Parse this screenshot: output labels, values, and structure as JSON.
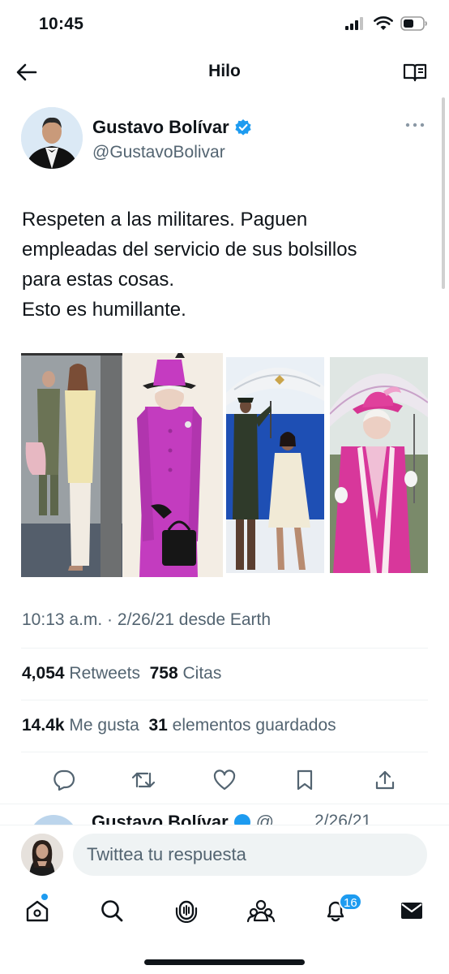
{
  "status_bar": {
    "time": "10:45"
  },
  "header": {
    "title": "Hilo"
  },
  "tweet": {
    "author_name": "Gustavo Bolívar",
    "handle": "@GustavoBolivar",
    "text_lines": [
      "Respeten a las militares. Paguen",
      "empleadas del servicio de sus bolsillos",
      "para estas cosas.",
      "Esto es humillante."
    ],
    "timestamp": "10:13 a.m. · 2/26/21 desde Earth",
    "retweets_count": "4,054",
    "retweets_label": "Retweets",
    "quotes_count": "758",
    "quotes_label": "Citas",
    "likes_count": "14.4k",
    "likes_label": "Me gusta",
    "bookmarks_count": "31",
    "bookmarks_label": "elementos guardados",
    "media": [
      {
        "icon": "photo-women-with-soldier"
      },
      {
        "icon": "photo-queen-purple-coat"
      },
      {
        "icon": "photo-soldier-holding-umbrella"
      },
      {
        "icon": "photo-queen-pink-coat-umbrella"
      }
    ]
  },
  "actions": [
    "reply-icon",
    "retweet-icon",
    "like-icon",
    "bookmark-icon",
    "share-icon"
  ],
  "next_tweet": {
    "author_name": "Gustavo Bolívar",
    "handle_prefix": "@",
    "date": "2/26/21"
  },
  "reply": {
    "placeholder": "Twittea tu respuesta"
  },
  "tab_bar": {
    "tabs": [
      "home-icon",
      "search-icon",
      "spaces-icon",
      "communities-icon",
      "notifications-icon",
      "messages-icon"
    ],
    "notifications_badge": "16"
  },
  "colors": {
    "accent": "#1d9bf0",
    "text": "#0f1419",
    "secondary": "#536471"
  }
}
